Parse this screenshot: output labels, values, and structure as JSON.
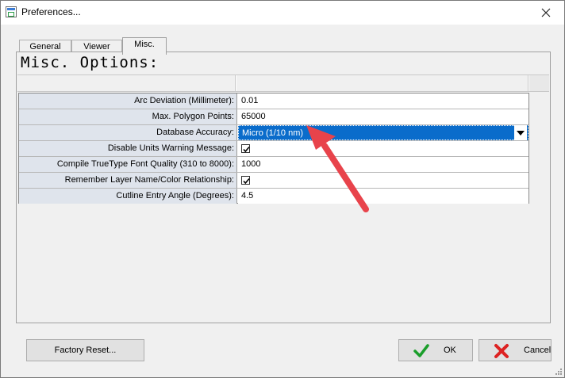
{
  "window": {
    "title": "Preferences..."
  },
  "tabs": [
    {
      "label": "General",
      "active": false
    },
    {
      "label": "Viewer",
      "active": false
    },
    {
      "label": "Misc.",
      "active": true
    }
  ],
  "panel": {
    "heading": "Misc. Options:"
  },
  "options": [
    {
      "label": "Arc Deviation (Millimeter):",
      "value": "0.01",
      "type": "text"
    },
    {
      "label": "Max. Polygon Points:",
      "value": "65000",
      "type": "text"
    },
    {
      "label": "Database Accuracy:",
      "value": "Micro (1/10 nm)",
      "type": "dropdown",
      "selected": true
    },
    {
      "label": "Disable Units Warning Message:",
      "checked": true,
      "type": "checkbox"
    },
    {
      "label": "Compile TrueType Font Quality (310 to 8000):",
      "value": "1000",
      "type": "text"
    },
    {
      "label": "Remember Layer Name/Color Relationship:",
      "checked": true,
      "type": "checkbox"
    },
    {
      "label": "Cutline Entry Angle (Degrees):",
      "value": "4.5",
      "type": "text"
    }
  ],
  "buttons": {
    "factory_reset": "Factory Reset...",
    "ok": "OK",
    "cancel": "Cancel"
  },
  "icons": {
    "close": "close-icon",
    "ok": "checkmark-icon",
    "cancel": "x-icon"
  },
  "colors": {
    "selection": "#0a6ccb",
    "annotation_arrow": "#e8434b",
    "label_bg": "#dfe4ec",
    "ok_icon": "#1a9e2a",
    "cancel_icon": "#d22"
  }
}
